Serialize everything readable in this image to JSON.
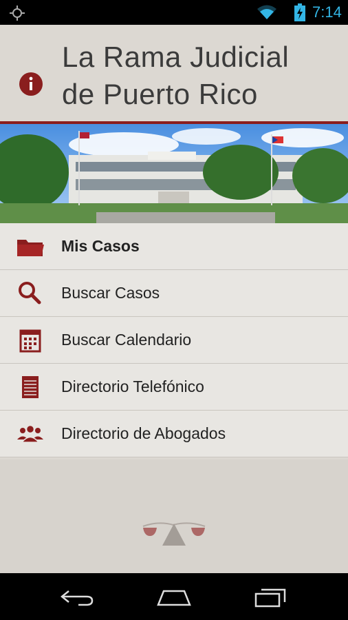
{
  "status_bar": {
    "time": "7:14",
    "icons": [
      "gps-icon",
      "wifi-icon",
      "battery-icon"
    ],
    "accent_color": "#33b5e5"
  },
  "header": {
    "title_line1": "La Rama Judicial",
    "title_line2": "de Puerto Rico",
    "info_icon": "info-icon"
  },
  "menu": {
    "items": [
      {
        "label": "Mis Casos",
        "icon": "folder-icon"
      },
      {
        "label": "Buscar Casos",
        "icon": "search-icon"
      },
      {
        "label": "Buscar Calendario",
        "icon": "calendar-icon"
      },
      {
        "label": "Directorio Telefónico",
        "icon": "phone-directory-icon"
      },
      {
        "label": "Directorio de Abogados",
        "icon": "lawyers-icon"
      }
    ]
  },
  "navigation": {
    "buttons": [
      "back-icon",
      "home-icon",
      "recent-apps-icon"
    ]
  },
  "colors": {
    "brand": "#8a1e1e",
    "background": "#dcd8d2"
  }
}
